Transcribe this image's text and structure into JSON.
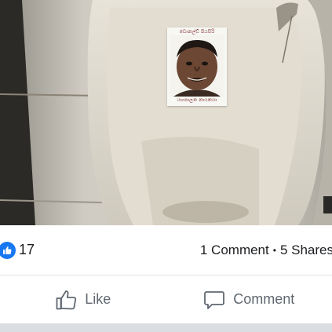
{
  "post": {
    "poster_caption_top": "ඩොනල්ඩ් පියසිරි",
    "poster_caption_bottom": "යහපාලන නායකයා"
  },
  "stats": {
    "reaction_icon": "like-icon",
    "reaction_count": "17",
    "comments": "1 Comment",
    "separator": "•",
    "shares": "5 Shares"
  },
  "actions": {
    "like_label": "Like",
    "like_icon": "thumbs-up-icon",
    "comment_label": "Comment",
    "comment_icon": "speech-bubble-icon"
  },
  "colors": {
    "brand_blue": "#1877f2",
    "action_gray": "#606770",
    "divider": "#e4e6eb"
  }
}
